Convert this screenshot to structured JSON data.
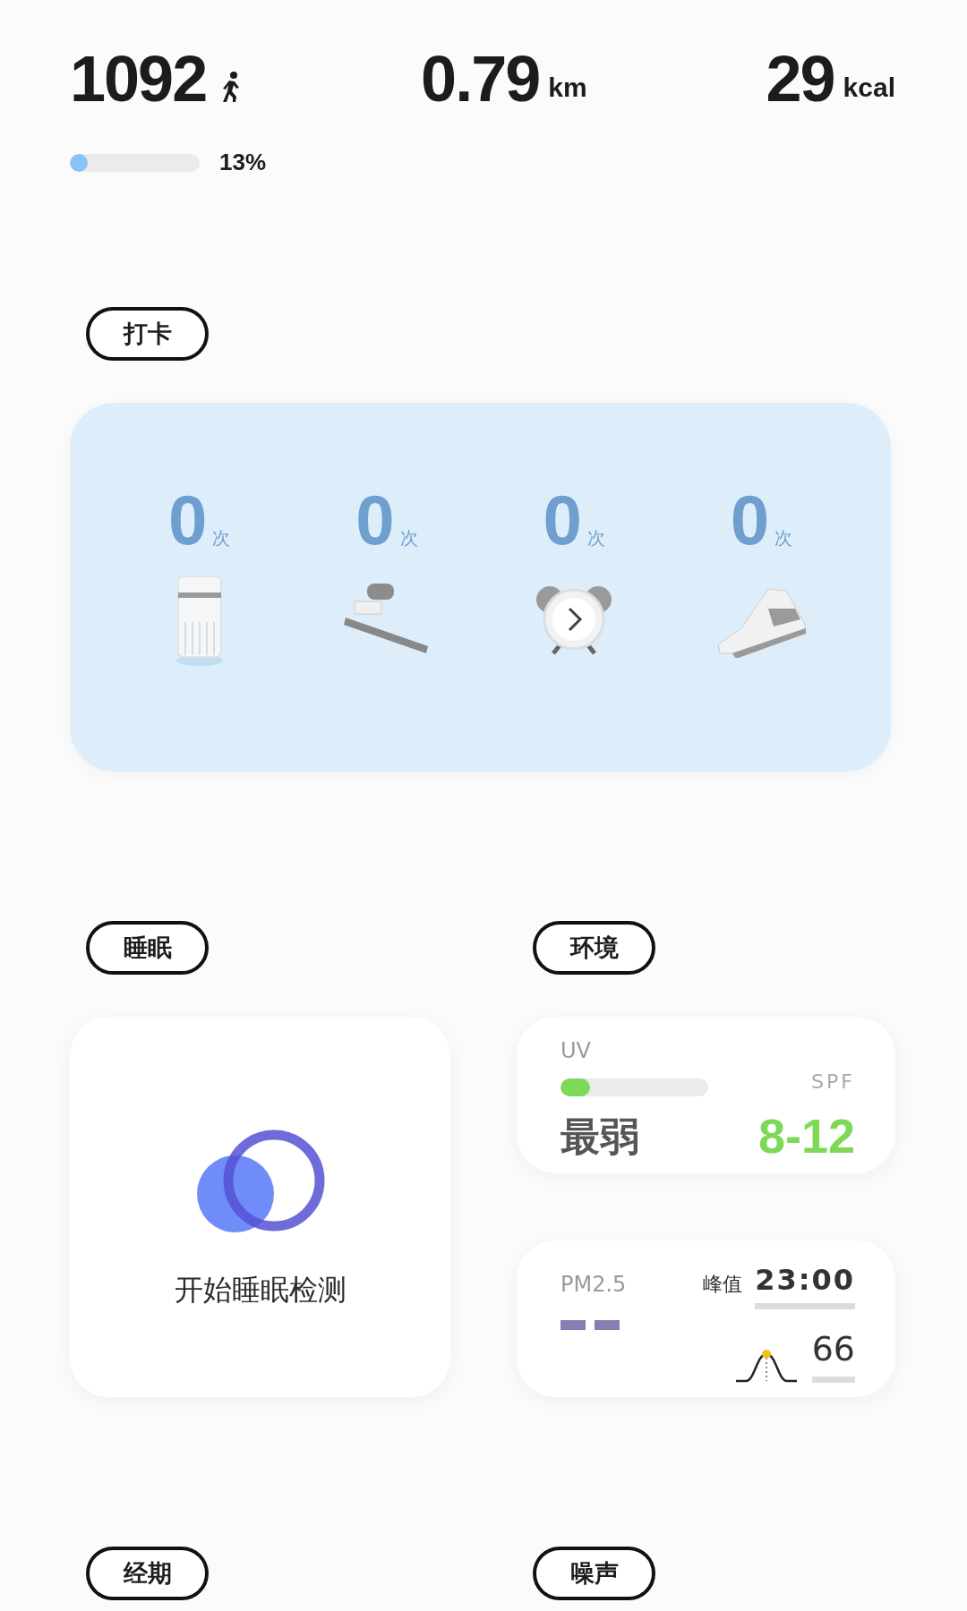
{
  "steps": {
    "value": "1092",
    "level": 0.13,
    "percent": "13%"
  },
  "distance": {
    "value": "0.79",
    "unit": "km"
  },
  "calories": {
    "value": "29",
    "unit": "kcal"
  },
  "checkin": {
    "title": "打卡",
    "items": [
      {
        "kind": "water",
        "count": "0",
        "unit": "次"
      },
      {
        "kind": "toothbrush",
        "count": "0",
        "unit": "次"
      },
      {
        "kind": "alarm",
        "count": "0",
        "unit": "次"
      },
      {
        "kind": "shoe",
        "count": "0",
        "unit": "次"
      }
    ]
  },
  "sleep": {
    "title": "睡眠",
    "action": "开始睡眠检测"
  },
  "environment": {
    "title": "环境",
    "uv": {
      "label": "UV",
      "level": 0.2,
      "grade": "最弱",
      "spf_label": "SPF",
      "spf": "8-12"
    },
    "pm25": {
      "label": "PM2.5",
      "peak_label": "峰值",
      "peak_time": "23:00",
      "peak_value": "66"
    }
  },
  "period": {
    "title": "经期"
  },
  "noise": {
    "title": "噪声"
  }
}
